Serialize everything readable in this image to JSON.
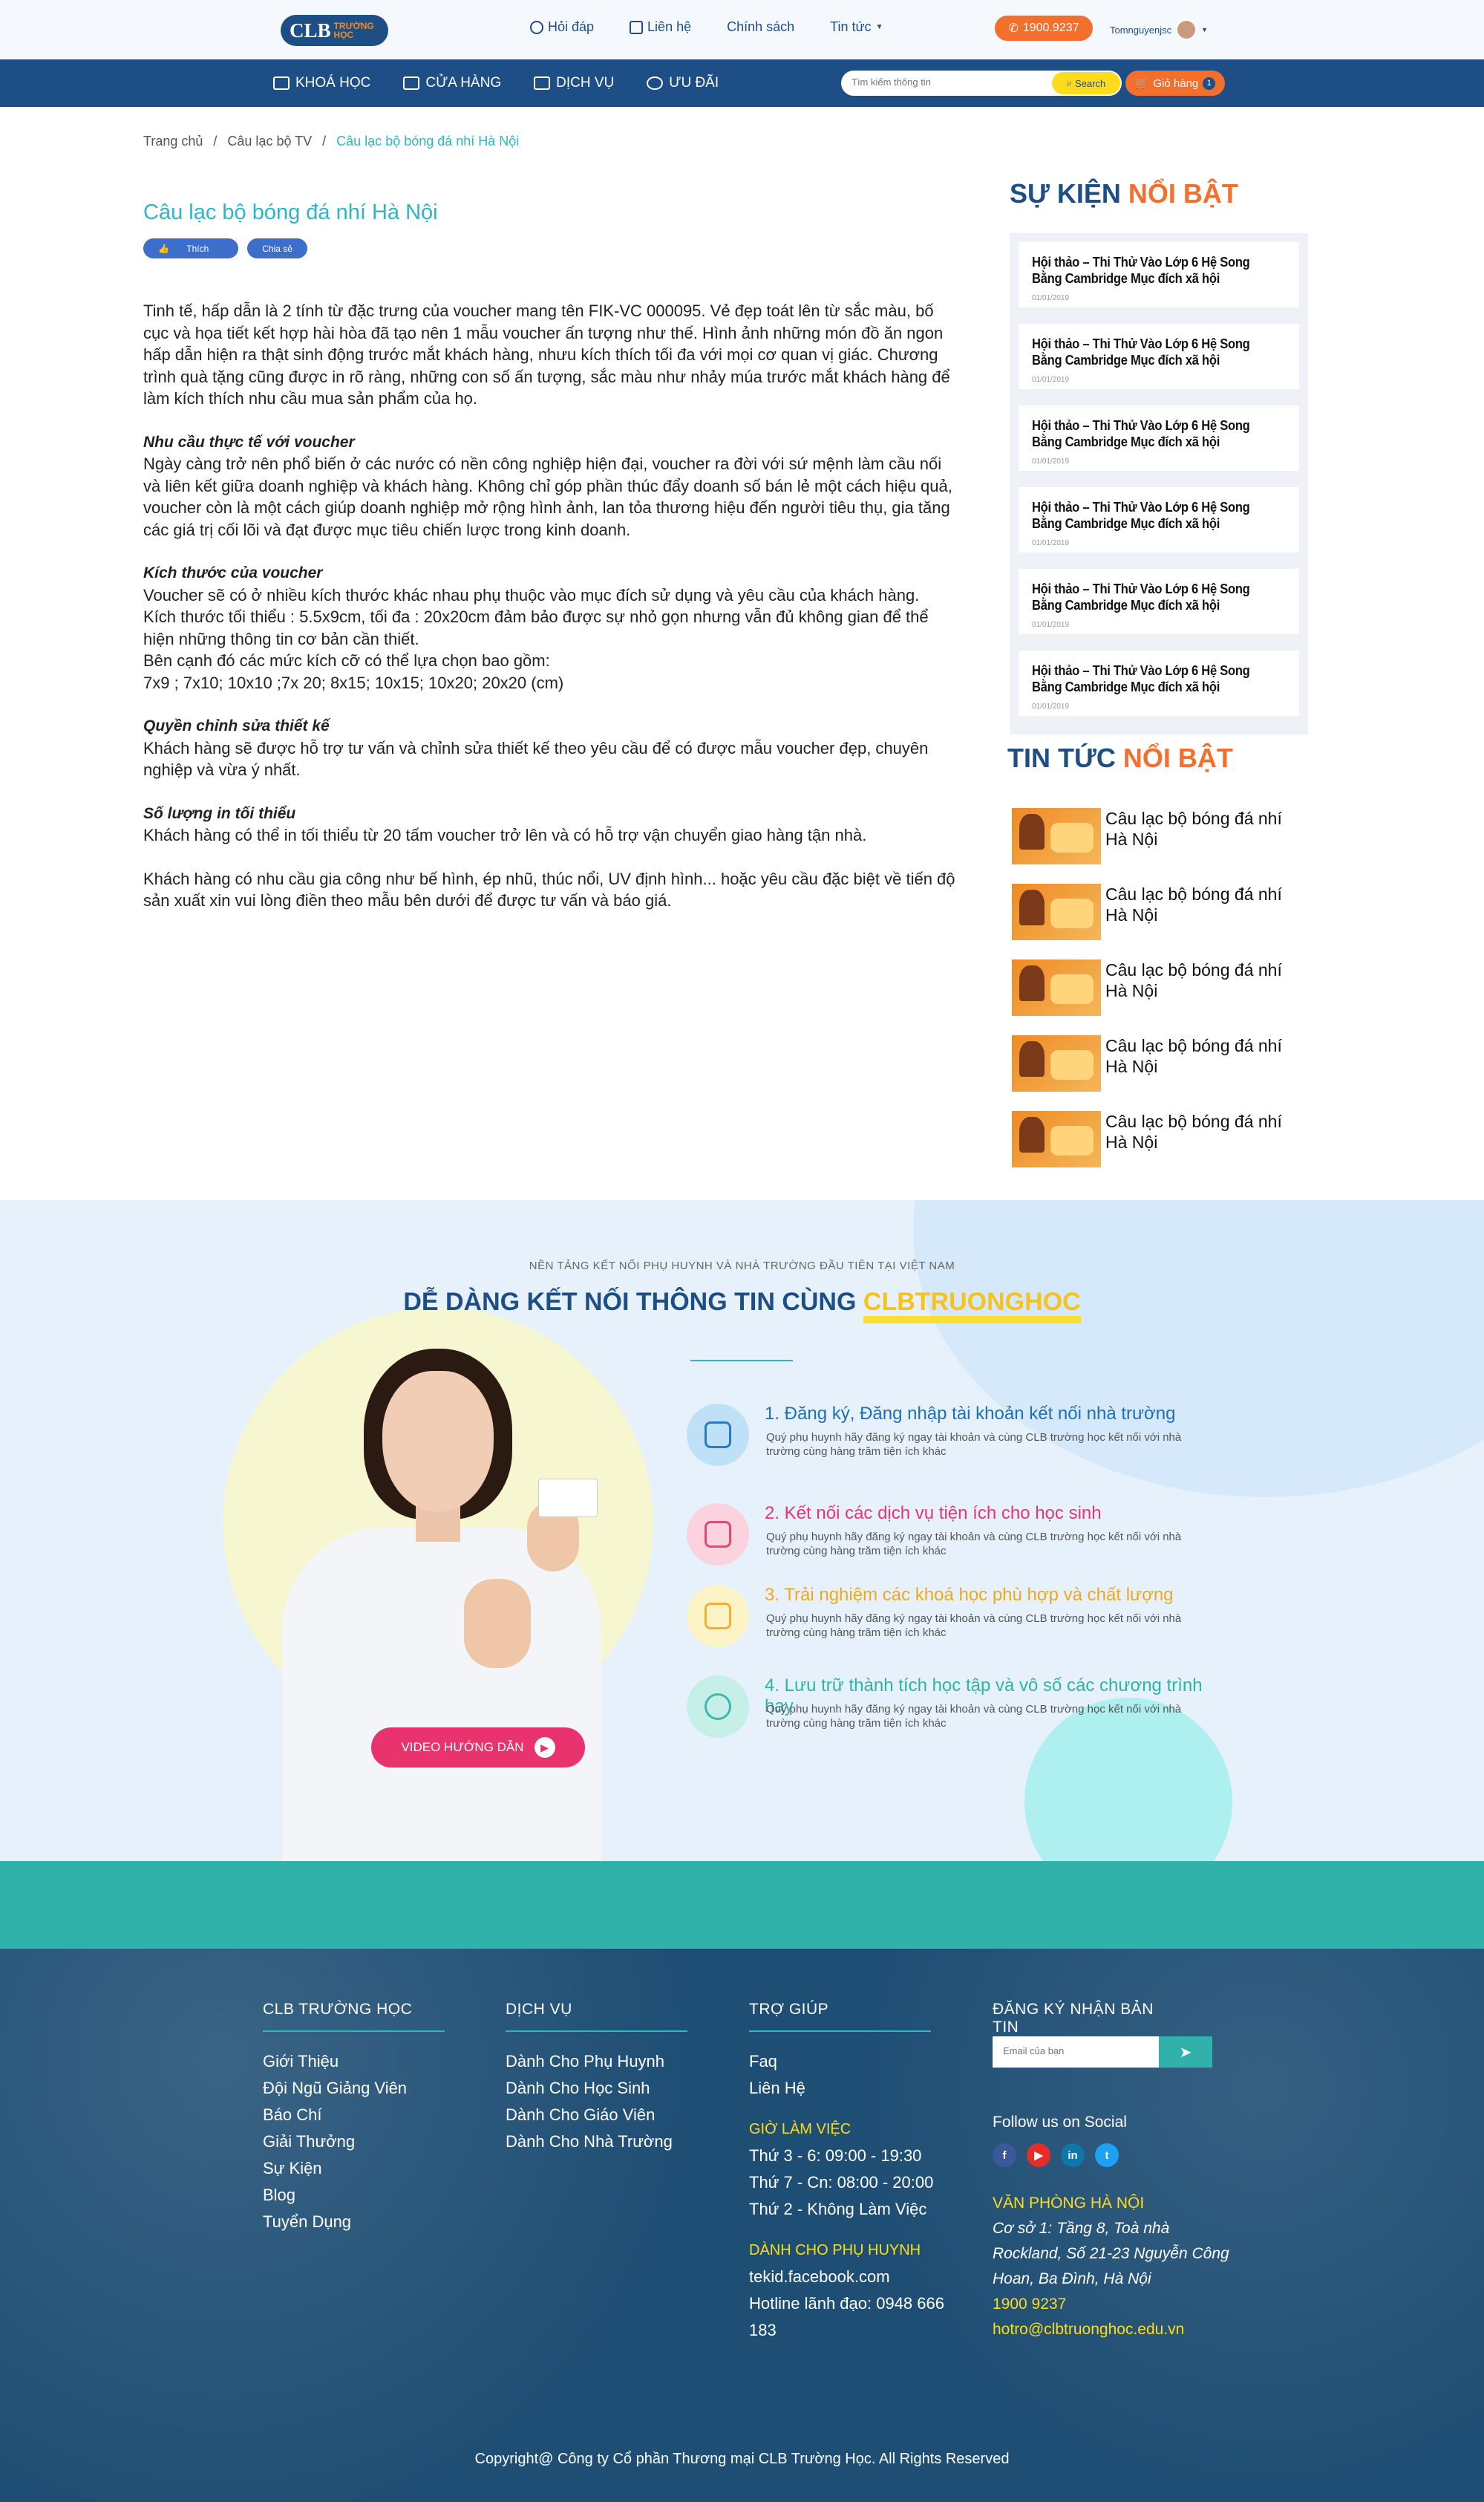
{
  "header": {
    "logo_main": "CLB",
    "logo_sub1": "TRƯỜNG",
    "logo_sub2": "HỌC",
    "nav": [
      "Hỏi đáp",
      "Liên hệ",
      "Chính sách",
      "Tin tức"
    ],
    "phone": "1900.9237",
    "user": "Tomnguyenjsc"
  },
  "mainnav": {
    "items": [
      "KHOÁ HỌC",
      "CỬA HÀNG",
      "DỊCH VỤ",
      "ƯU ĐÃI"
    ],
    "search_placeholder": "Tìm kiếm thông tin",
    "search_btn": "Search",
    "cart_label": "Giỏ hàng",
    "cart_count": "1"
  },
  "breadcrumb": [
    "Trang chủ",
    "Câu lạc bộ TV",
    "Câu lạc bộ bóng đá nhí Hà Nội"
  ],
  "article": {
    "title": "Câu lạc bộ bóng đá nhí Hà Nội",
    "like": "Thích",
    "share": "Chia sẻ",
    "p1": "Tinh tế, hấp dẫn là 2 tính từ đặc trưng của voucher mang tên FIK-VC 000095. Vẻ đẹp toát lên từ sắc màu, bố cục và họa tiết kết hợp hài hòa đã tạo nên 1 mẫu voucher ấn tượng như thế. Hình ảnh những món đồ ăn ngon hấp dẫn hiện ra thật sinh động trước mắt khách hàng, nhưu kích thích tối đa với mọi cơ quan vị giác. Chương trình quà tặng cũng được in rõ ràng, những con số ấn tượng, sắc màu như nhảy múa trước mắt khách hàng để làm kích thích nhu cầu mua sản phẩm của họ.",
    "h2": "Nhu cầu thực tế với voucher",
    "p2": "Ngày càng trở nên phổ biến ở các nước có nền công nghiệp hiện đại, voucher ra đời với sứ mệnh làm cầu nối và liên kết giữa doanh nghiệp và khách hàng. Không chỉ góp phần thúc đẩy doanh số bán lẻ một cách hiệu quả, voucher còn là một cách giúp doanh nghiệp mở rộng hình ảnh, lan tỏa thương hiệu đến người tiêu thụ, gia tăng các giá trị cối lõi và đạt được mục tiêu chiến lược trong kinh doanh.",
    "h3": "Kích thước của voucher",
    "p3a": "Voucher sẽ có ở nhiều kích thước khác nhau phụ thuộc vào mục đích sử dụng và yêu cầu của khách hàng.",
    "p3b": "Kích thước tối thiểu : 5.5x9cm,  tối đa : 20x20cm đảm bảo được sự nhỏ gọn nhưng vẫn đủ không gian để thể hiện những thông tin cơ bản cần thiết.",
    "p3c": "Bên cạnh đó các mức kích cỡ có thể lựa chọn bao gồm:",
    "p3d": "7x9 ; 7x10; 10x10 ;7x 20; 8x15; 10x15; 10x20; 20x20 (cm)",
    "h4": "Quyền chỉnh sửa thiết kế",
    "p4": "Khách hàng sẽ được hỗ trợ tư vấn và chỉnh sửa thiết kế theo yêu cầu để có được mẫu voucher đẹp, chuyên nghiệp và vừa ý nhất.",
    "h5": "Số lượng in tối thiểu",
    "p5": "Khách hàng có thể in tối thiểu từ 20 tấm voucher trở lên và có hỗ trợ vận chuyển giao hàng tận nhà.",
    "p6": "Khách hàng có nhu cầu gia công như bế hình, ép nhũ, thúc nổi, UV định hình... hoặc yêu cầu đặc biệt về tiến độ sản xuất xin vui lòng điền theo mẫu bên dưới để được tư vấn và báo giá."
  },
  "sidebar": {
    "events_title_a": "SỰ KIỆN ",
    "events_title_b": "NỔI BẬT",
    "events": [
      {
        "title": "Hội thảo – Thi Thử Vào Lớp 6 Hệ Song Bằng Cambridge Mục đích xã hội",
        "date": "01/01/2019"
      },
      {
        "title": "Hội thảo – Thi Thử Vào Lớp 6 Hệ Song Bằng Cambridge Mục đích xã hội",
        "date": "01/01/2019"
      },
      {
        "title": "Hội thảo – Thi Thử Vào Lớp 6 Hệ Song Bằng Cambridge Mục đích xã hội",
        "date": "01/01/2019"
      },
      {
        "title": "Hội thảo – Thi Thử Vào Lớp 6 Hệ Song Bằng Cambridge Mục đích xã hội",
        "date": "01/01/2019"
      },
      {
        "title": "Hội thảo – Thi Thử Vào Lớp 6 Hệ Song Bằng Cambridge Mục đích xã hội",
        "date": "01/01/2019"
      },
      {
        "title": "Hội thảo – Thi Thử Vào Lớp 6 Hệ Song Bằng Cambridge Mục đích xã hội",
        "date": "01/01/2019"
      }
    ],
    "news_title_a": "TIN TỨC ",
    "news_title_b": "NỔI BẬT",
    "news": [
      "Câu lạc bộ bóng đá nhí Hà Nội",
      "Câu lạc bộ bóng đá nhí Hà Nội",
      "Câu lạc bộ bóng đá nhí Hà Nội",
      "Câu lạc bộ bóng đá nhí Hà Nội",
      "Câu lạc bộ bóng đá nhí Hà Nội"
    ]
  },
  "connect": {
    "subtitle": "NỀN TẢNG KẾT NỐI PHỤ HUYNH VÀ NHÀ TRƯỜNG ĐẦU TIÊN TẠI VIỆT NAM",
    "title_a": "DỄ DÀNG KẾT NỐI THÔNG TIN CÙNG ",
    "title_b": "CLBTRUONGHOC",
    "video_btn": "VIDEO HƯỚNG DẪN",
    "features": [
      {
        "title": "1. Đăng ký, Đăng nhập tài khoản kết nối nhà trường",
        "desc": "Quý phụ huynh hãy đăng ký ngay tài khoản và cùng CLB trường học kết nối với nhà trường cùng hàng trăm tiện ích khác",
        "color": "#1e6fb8",
        "bg": "#bfe1f7"
      },
      {
        "title": "2. Kết nối các dịch vụ tiện ích cho học sinh",
        "desc": "Quý phụ huynh hãy đăng ký ngay tài khoản và cùng CLB trường học kết nối với nhà trường cùng hàng trăm tiện ích khác",
        "color": "#e2386c",
        "bg": "#fbd3de"
      },
      {
        "title": "3. Trải nghiệm các khoá học phù hợp và chất lượng",
        "desc": "Quý phụ huynh hãy đăng ký ngay tài khoản và cùng CLB trường học kết nối với nhà trường cùng hàng trăm tiện ích khác",
        "color": "#f0a81c",
        "bg": "#fcf3c6"
      },
      {
        "title": "4. Lưu trữ thành tích học tập và vô số các chương trình hay",
        "desc": "Quý phụ huynh hãy đăng ký ngay tài khoản và cùng CLB trường học kết nối với nhà trường cùng hàng trăm tiện ích khác",
        "color": "#2fb3a9",
        "bg": "#c6efe8"
      }
    ]
  },
  "footer": {
    "col1_title": "CLB TRƯỜNG HỌC",
    "col1": [
      "Giới Thiệu",
      "Đội Ngũ Giảng Viên",
      "Báo Chí",
      "Giải Thưởng",
      "Sự Kiện",
      "Blog",
      "Tuyển Dụng"
    ],
    "col2_title": "DỊCH VỤ",
    "col2": [
      "Dành Cho Phụ Huynh",
      "Dành Cho Học Sinh",
      "Dành Cho Giáo Viên",
      "Dành Cho Nhà Trường"
    ],
    "col3_title": "TRỢ GIÚP",
    "col3": [
      "Faq",
      "Liên Hệ"
    ],
    "hours_title": "GIỜ LÀM VIỆC",
    "hours": [
      "Thứ 3 - 6: 09:00 - 19:30",
      "Thứ 7 - Cn: 08:00 - 20:00",
      "Thứ 2 - Không Làm Việc"
    ],
    "parents_title": "DÀNH CHO PHỤ HUYNH",
    "parents": [
      "tekid.facebook.com",
      "Hotline lãnh đạo: 0948 666 183"
    ],
    "col4_title": "ĐĂNG KÝ NHẬN BẢN TIN",
    "email_placeholder": "Email của bạn",
    "social_title": "Follow us on Social",
    "office_title": "VĂN PHÒNG HÀ NỘI",
    "office_addr": "Cơ sở 1: Tầng 8, Toà nhà Rockland, Số 21-23 Nguyễn Công Hoan, Ba Đình, Hà Nội",
    "office_phone": "1900 9237",
    "office_email": "hotro@clbtruonghoc.edu.vn",
    "copyright": "Copyright@ Công ty Cổ phần Thương mại CLB Trường Học. All Rights Reserved"
  },
  "colors": {
    "primary": "#1e4e86",
    "accent": "#f36f2c",
    "teal": "#2db6c8",
    "yellow": "#fedc1c"
  }
}
